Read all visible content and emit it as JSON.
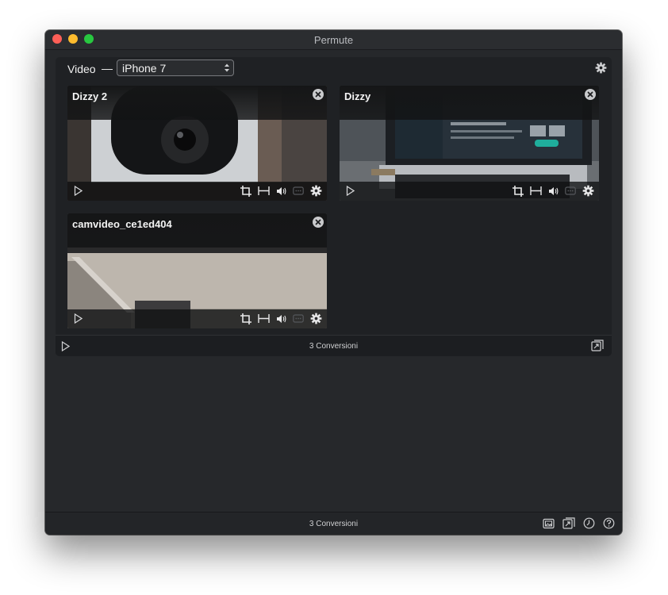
{
  "app": {
    "title": "Permute",
    "traffic_colors": {
      "close": "#fe5f57",
      "minimize": "#febc2e",
      "maximize": "#28c840"
    }
  },
  "preset": {
    "label": "Video",
    "dash": "—",
    "selected": "iPhone 7"
  },
  "cards": [
    {
      "title": "Dizzy 2",
      "thumbnail": "camera-closeup"
    },
    {
      "title": "Dizzy",
      "thumbnail": "laptop-screen"
    },
    {
      "title": "camvideo_ce1ed404",
      "thumbnail": "room-corner"
    }
  ],
  "card_tools": [
    "crop-icon",
    "trim-icon",
    "audio-icon",
    "subtitles-icon",
    "gear-icon"
  ],
  "panel_footer": {
    "label": "3 Conversioni"
  },
  "status_bar": {
    "label": "3 Conversioni",
    "icons": [
      "image-queue-icon",
      "convert-icon",
      "history-clock-icon",
      "help-icon"
    ]
  }
}
